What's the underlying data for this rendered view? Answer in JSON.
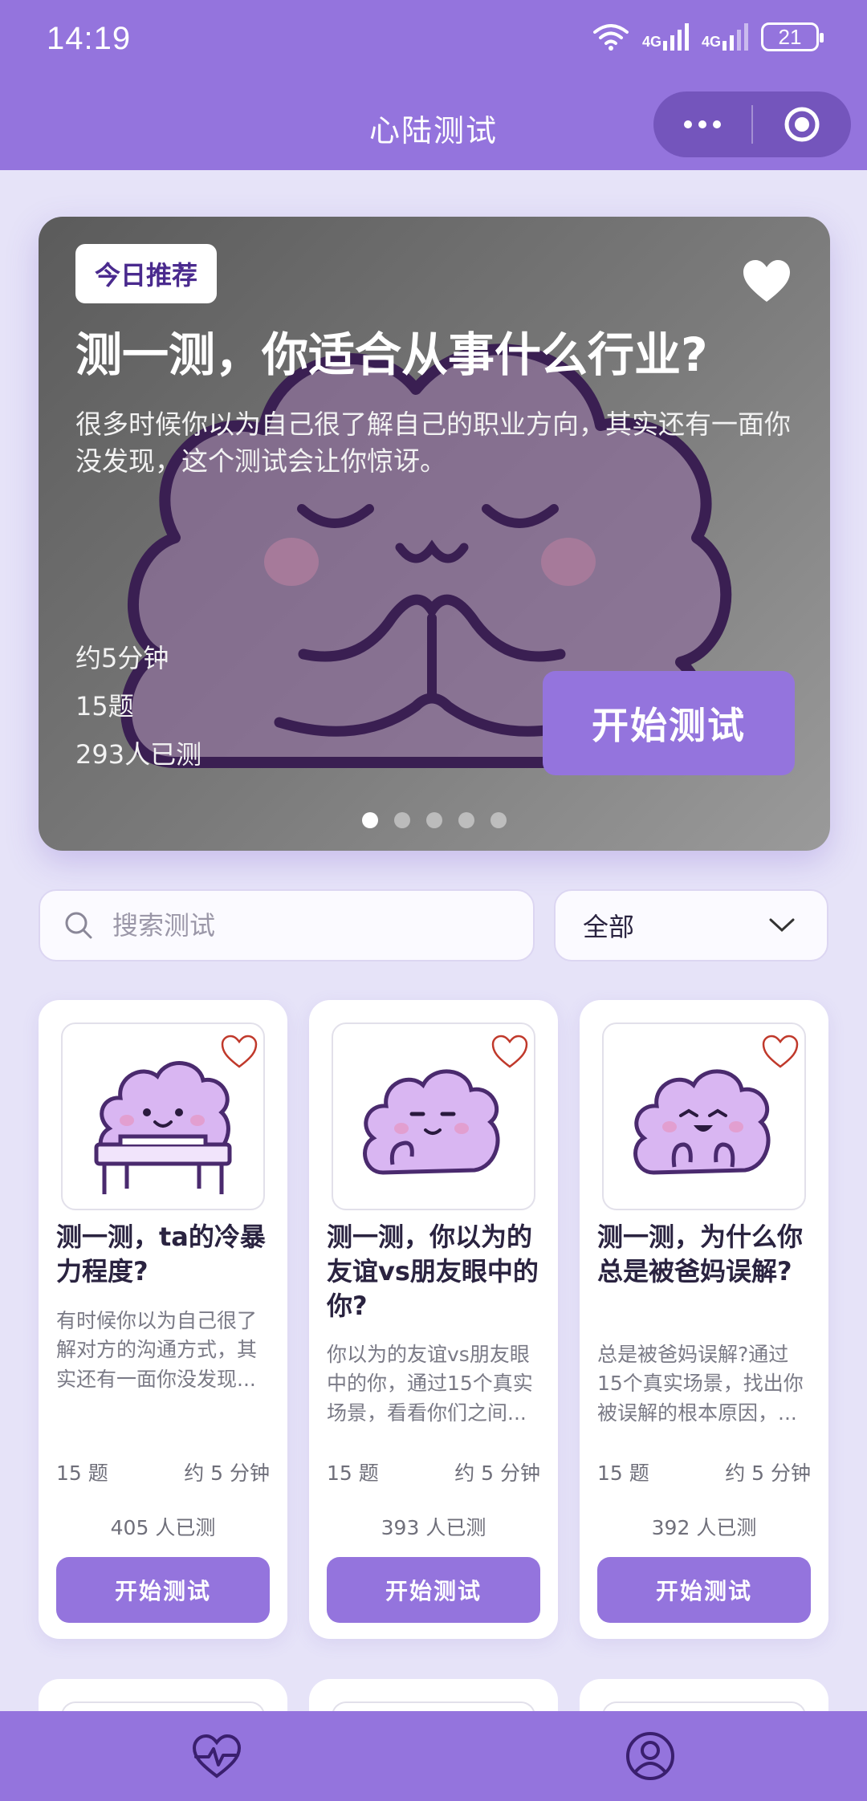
{
  "status_bar": {
    "time": "14:19",
    "network_1": "4G",
    "network_2": "4G",
    "battery": "21"
  },
  "header": {
    "title": "心陆测试",
    "more_icon": "more-dots-icon",
    "close_icon": "target-circle-icon"
  },
  "featured": {
    "badge": "今日推荐",
    "title": "测一测，你适合从事什么行业?",
    "description": "很多时候你以为自己很了解自己的职业方向，其实还有一面你没发现，这个测试会让你惊讶。",
    "duration": "约5分钟",
    "questions": "15题",
    "participants": "293人已测",
    "start_label": "开始测试",
    "carousel_count": 5,
    "carousel_active": 0
  },
  "search": {
    "placeholder": "搜索测试",
    "value": ""
  },
  "filter": {
    "selected": "全部"
  },
  "tests": [
    {
      "title": "测一测，ta的冷暴力程度?",
      "description": "有时候你以为自己很了解对方的沟通方式，其实还有一面你没发现...",
      "questions": "15 题",
      "duration": "约 5 分钟",
      "participants": "405 人已测",
      "start_label": "开始测试"
    },
    {
      "title": "测一测，你以为的友谊vs朋友眼中的你?",
      "description": "你以为的友谊vs朋友眼中的你，通过15个真实场景，看看你们之间...",
      "questions": "15 题",
      "duration": "约 5 分钟",
      "participants": "393 人已测",
      "start_label": "开始测试"
    },
    {
      "title": "测一测，为什么你总是被爸妈误解?",
      "description": "总是被爸妈误解?通过15个真实场景，找出你被误解的根本原因，...",
      "questions": "15 题",
      "duration": "约 5 分钟",
      "participants": "392 人已测",
      "start_label": "开始测试"
    }
  ],
  "tabbar": {
    "tabs": [
      {
        "icon": "heart-pulse-icon"
      },
      {
        "icon": "user-profile-icon"
      }
    ]
  },
  "colors": {
    "primary": "#9474dd",
    "background": "#e6e3f8",
    "heart_outline": "#c0392b"
  }
}
